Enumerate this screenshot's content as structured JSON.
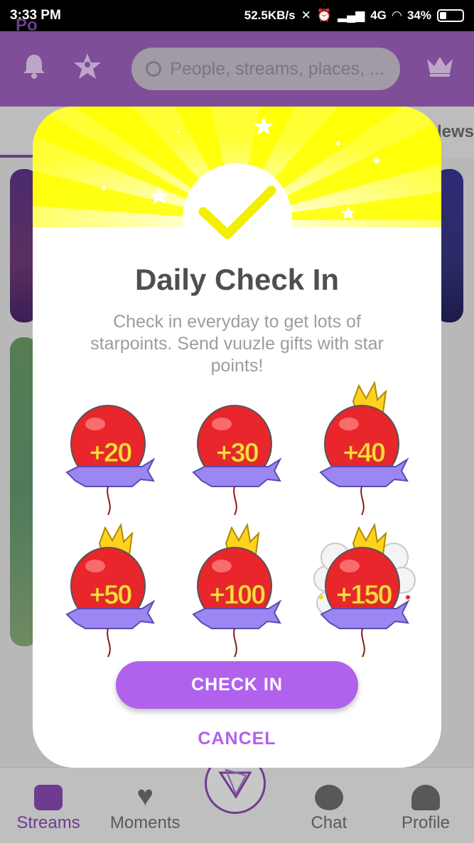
{
  "status_bar": {
    "time": "3:33 PM",
    "network_speed": "52.5KB/s",
    "signal": "4G",
    "battery": "34%"
  },
  "header": {
    "search_placeholder": "People, streams, places, ...",
    "icons": [
      "bell-icon",
      "star-badge-icon",
      "crown-icon"
    ]
  },
  "tabs": {
    "left_partial": "Po",
    "right_partial": "lews"
  },
  "dialog": {
    "title": "Daily Check In",
    "subtitle": "Check in everyday to get lots of starpoints. Send vuuzle gifts with star points!",
    "rewards": [
      {
        "label": "+20",
        "crown": false,
        "cloud": false
      },
      {
        "label": "+30",
        "crown": false,
        "cloud": false
      },
      {
        "label": "+40",
        "crown": true,
        "cloud": false
      },
      {
        "label": "+50",
        "crown": true,
        "cloud": false
      },
      {
        "label": "+100",
        "crown": true,
        "cloud": false
      },
      {
        "label": "+150",
        "crown": true,
        "cloud": true
      }
    ],
    "check_in_label": "CHECK IN",
    "cancel_label": "CANCEL",
    "colors": {
      "accent": "#b062ec",
      "balloon": "#e8262b",
      "ribbon": "#9b86f2",
      "burst": "#ffff33"
    }
  },
  "bottom_nav": {
    "items": [
      {
        "label": "Streams",
        "icon": "streams-icon",
        "active": true
      },
      {
        "label": "Moments",
        "icon": "heart-icon",
        "active": false
      },
      {
        "label": "Chat",
        "icon": "chat-icon",
        "active": false
      },
      {
        "label": "Profile",
        "icon": "profile-icon",
        "active": false
      }
    ]
  }
}
